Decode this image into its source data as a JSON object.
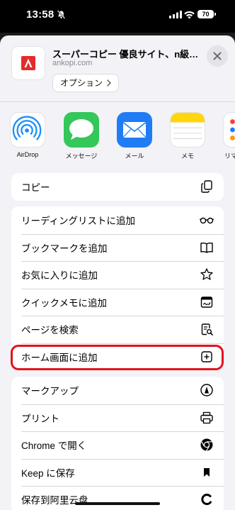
{
  "status_bar": {
    "time": "13:58",
    "battery": "70"
  },
  "share_sheet": {
    "site_title": "スーパーコピー 優良サイト、n級品ブ…",
    "site_domain": "ankopi.com",
    "options_label": "オプション",
    "apps": [
      {
        "label": "AirDrop",
        "icon": "airdrop-icon",
        "color": "#1c8ef9"
      },
      {
        "label": "メッセージ",
        "icon": "messages-icon",
        "color": "#34c759"
      },
      {
        "label": "メール",
        "icon": "mail-icon",
        "color": "#1f7cf5"
      },
      {
        "label": "メモ",
        "icon": "notes-icon",
        "color": "#ffd60a"
      },
      {
        "label": "リマ",
        "icon": "reminders-icon",
        "color": "#ffffff"
      }
    ],
    "copy_group": [
      {
        "label": "コピー",
        "icon": "copy-icon"
      }
    ],
    "actions_group": [
      {
        "label": "リーディングリストに追加",
        "icon": "glasses-icon"
      },
      {
        "label": "ブックマークを追加",
        "icon": "book-icon"
      },
      {
        "label": "お気に入りに追加",
        "icon": "star-icon"
      },
      {
        "label": "クイックメモに追加",
        "icon": "quick-note-icon"
      },
      {
        "label": "ページを検索",
        "icon": "find-in-page-icon"
      },
      {
        "label": "ホーム画面に追加",
        "icon": "add-square-icon",
        "highlighted": true
      }
    ],
    "extensions_group": [
      {
        "label": "マークアップ",
        "icon": "markup-icon"
      },
      {
        "label": "プリント",
        "icon": "printer-icon"
      },
      {
        "label": "Chrome で開く",
        "icon": "chrome-icon"
      },
      {
        "label": "Keep に保存",
        "icon": "bookmark-icon"
      },
      {
        "label": "保存到阿里云盘",
        "icon": "aliyun-icon"
      }
    ],
    "highlight_color": "#e0141e"
  }
}
